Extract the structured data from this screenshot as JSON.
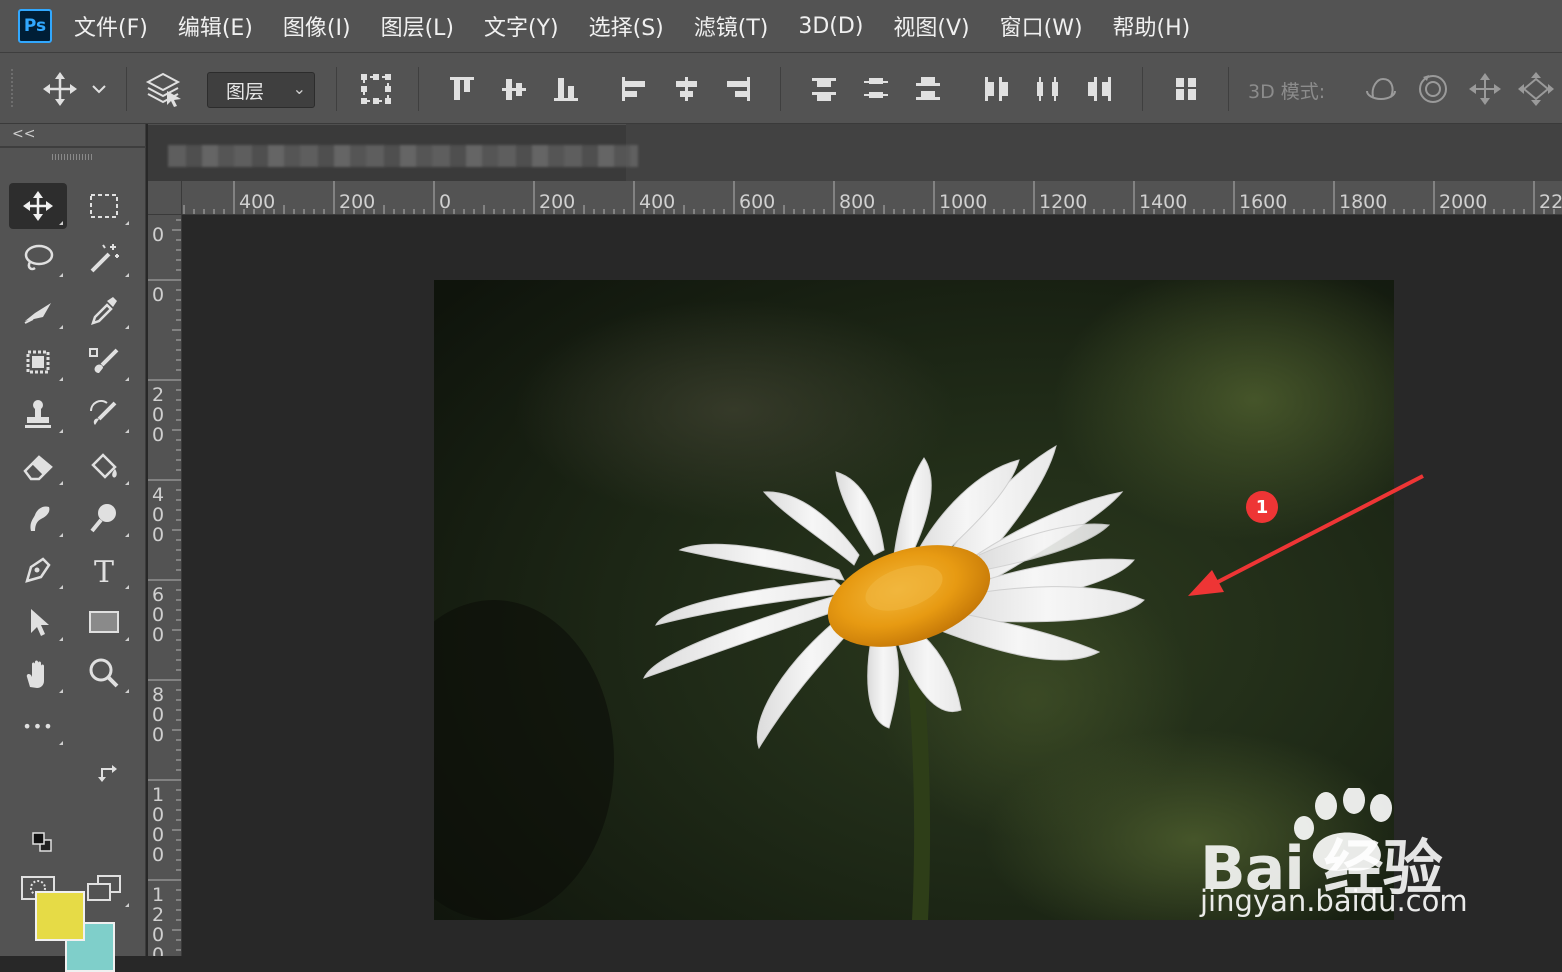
{
  "app": {
    "logo_text": "Ps"
  },
  "menu": {
    "items": [
      "文件(F)",
      "编辑(E)",
      "图像(I)",
      "图层(L)",
      "文字(Y)",
      "选择(S)",
      "滤镜(T)",
      "3D(D)",
      "视图(V)",
      "窗口(W)",
      "帮助(H)"
    ]
  },
  "options_bar": {
    "auto_select_target": "图层",
    "mode_3d_label": "3D 模式:",
    "icons": [
      "move-tool-icon",
      "auto-select-layers-icon",
      "show-transform-controls-icon",
      "align-top-icon",
      "align-vcenter-icon",
      "align-bottom-icon",
      "align-left-icon",
      "align-hcenter-icon",
      "align-right-icon",
      "distribute-top-icon",
      "distribute-vcenter-icon",
      "distribute-bottom-icon",
      "distribute-left-icon",
      "distribute-hcenter-icon",
      "distribute-right-icon",
      "auto-align-layers-icon",
      "rotate-3d-icon",
      "roll-3d-icon",
      "drag-3d-icon",
      "slide-3d-icon"
    ]
  },
  "toolbox": {
    "collapse_label": "<<",
    "tools": [
      "move-tool",
      "marquee-tool",
      "lasso-tool",
      "magic-wand-tool",
      "healing-brush-tool",
      "eyedropper-tool",
      "crop-tool",
      "brush-tool",
      "clone-stamp-tool",
      "history-brush-tool",
      "eraser-tool",
      "paint-bucket-tool",
      "smudge-tool",
      "dodge-tool",
      "pen-tool",
      "type-tool",
      "path-selection-tool",
      "rectangle-tool",
      "hand-tool",
      "zoom-tool",
      "edit-toolbar",
      "quick-mask",
      "screen-mode"
    ],
    "type_tool_glyph": "T",
    "more_glyph": "•••",
    "foreground_color": "#e6db46",
    "background_color": "#7fcfca"
  },
  "rulers": {
    "horizontal_labels": [
      "400",
      "200",
      "0",
      "200",
      "400",
      "600",
      "800",
      "1000",
      "1200",
      "1400",
      "1600",
      "1800",
      "2000",
      "22"
    ],
    "vertical_labels": [
      "0",
      "0",
      "200",
      "400",
      "600",
      "800",
      "1000",
      "1200"
    ]
  },
  "annotation": {
    "badge_number": "1",
    "color": "#ee3535"
  },
  "watermark": {
    "brand": "Bai 经验",
    "url": "jingyan.baidu.com"
  }
}
